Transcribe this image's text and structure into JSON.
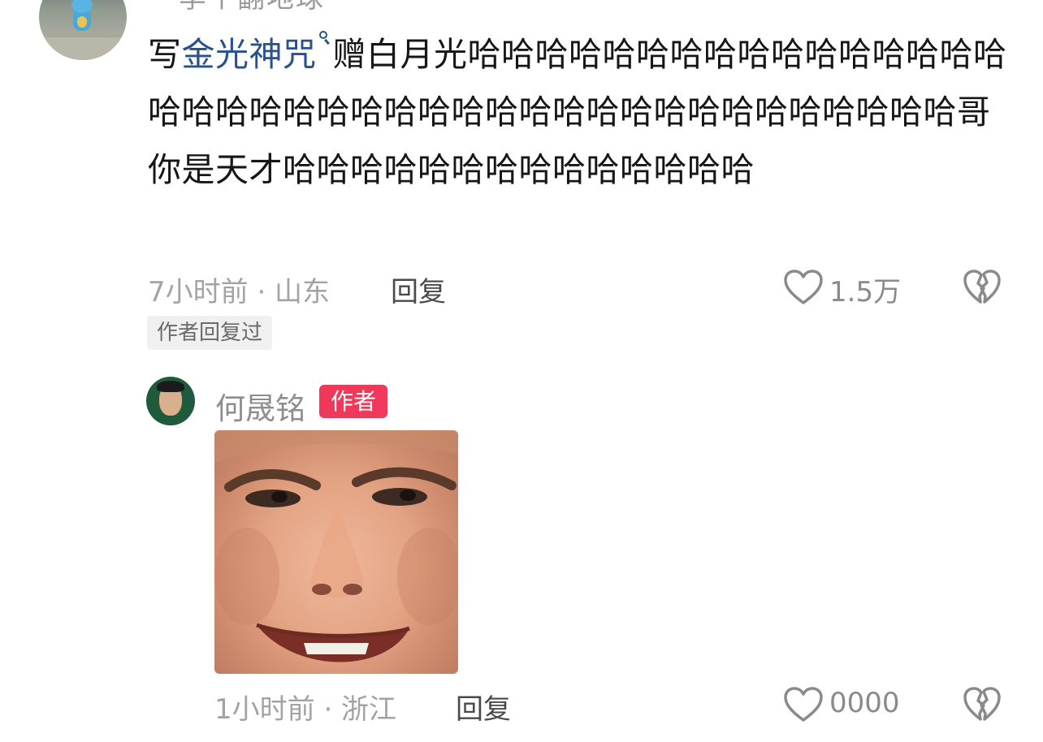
{
  "top_comment": {
    "cut_username": "李个翻地球",
    "text_prefix": "写",
    "search_link": "金光神咒",
    "text_rest": "赠白月光哈哈哈哈哈哈哈哈哈哈哈哈哈哈哈哈哈哈哈哈哈哈哈哈哈哈哈哈哈哈哈哈哈哈哈哈哈哈哈哈哥你是天才哈哈哈哈哈哈哈哈哈哈哈哈哈哈",
    "time_location": "7小时前 · 山东",
    "reply_label": "回复",
    "like_count": "1.5万",
    "badge": "作者回复过"
  },
  "reply": {
    "author_name": "何晟铭",
    "author_tag": "作者",
    "time_location": "1小时前 · 浙江",
    "reply_label": "回复",
    "like_count": "0000"
  },
  "icons": {
    "like": "heart-outline-icon",
    "dislike": "broken-heart-icon",
    "search": "search-icon"
  },
  "colors": {
    "link": "#27528a",
    "author_tag_bg": "#f0395a",
    "meta_text": "#a3a3a3"
  }
}
